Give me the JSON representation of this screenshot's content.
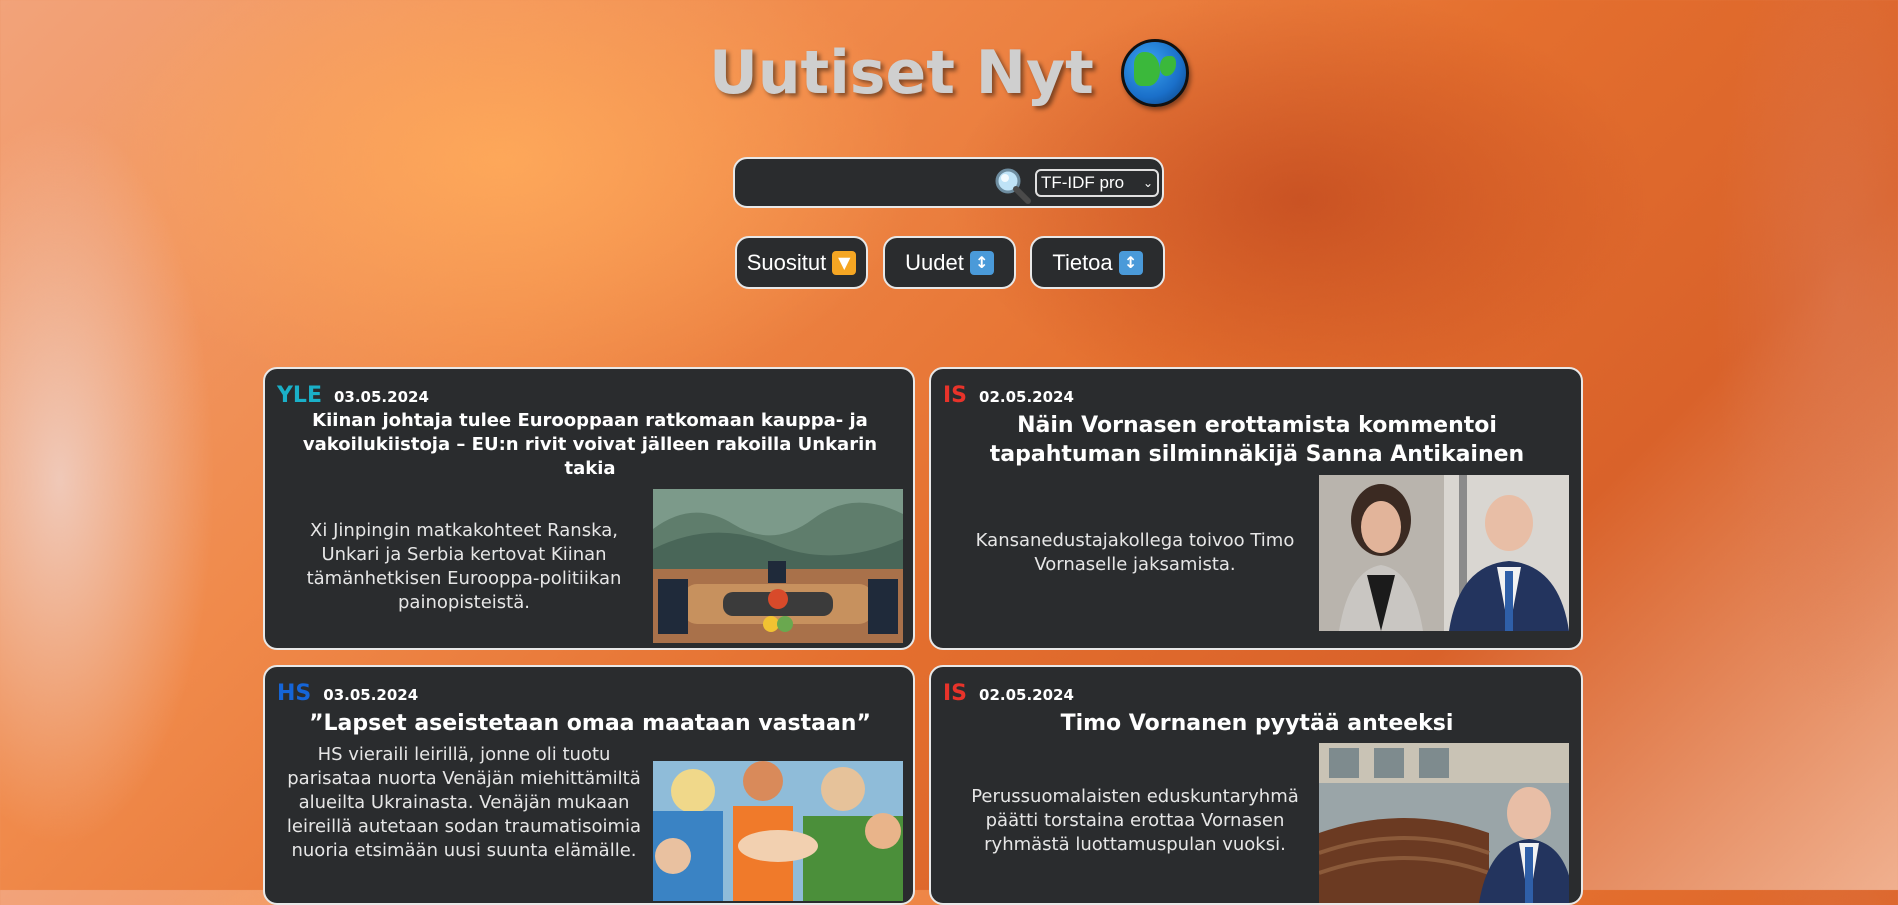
{
  "header": {
    "title": "Uutiset Nyt",
    "logo_icon": "globe-earth-africa-icon"
  },
  "search": {
    "value": "",
    "placeholder": "",
    "algorithm_selected": "TF-IDF pro",
    "icon": "magnifying-glass-icon"
  },
  "nav": {
    "popular_label": "Suositut",
    "popular_icon": "down-arrow-orange-icon",
    "new_label": "Uudet",
    "new_icon": "up-down-arrow-icon",
    "about_label": "Tietoa",
    "about_icon": "up-down-arrow-icon"
  },
  "articles": [
    {
      "source": "YLE",
      "source_color": "#1ab0c8",
      "date": "03.05.2024",
      "headline": "Kiinan johtaja tulee Eurooppaan ratkomaan kauppa- ja vakoilukiistoja – EU:n rivit voivat jälleen rakoilla Unkarin takia",
      "summary": "Xi Jinpingin matkakohteet Ranska, Unkari ja Serbia kertovat Kiinan tämänhetkisen Eurooppa-politiikan painopisteistä.",
      "image": "conference-table-photo"
    },
    {
      "source": "IS",
      "source_color": "#e8332a",
      "date": "02.05.2024",
      "headline": "Näin Vornasen erottamista kommentoi tapahtuman silminnäkijä Sanna Antikainen",
      "summary": "Kansanedustajakollega toivoo Timo Vornaselle jaksamista.",
      "image": "two-portraits-photo"
    },
    {
      "source": "HS",
      "source_color": "#1565d8",
      "date": "03.05.2024",
      "headline": "”Lapset aseistetaan omaa maataan vastaan”",
      "summary": "HS vieraili leirillä, jonne oli tuotu parisataa nuorta Venäjän miehittämiltä alueilta Ukrainasta. Venäjän mukaan leireillä autetaan sodan traumatisoimia nuoria etsimään uusi suunta elämälle.",
      "image": "youth-camp-photo"
    },
    {
      "source": "IS",
      "source_color": "#e8332a",
      "date": "02.05.2024",
      "headline": "Timo Vornanen pyytää anteeksi",
      "summary": "Perussuomalaisten eduskuntaryhmä päätti torstaina erottaa Vornasen ryhmästä luottamuspulan vuoksi.",
      "image": "parliament-and-portrait-photo"
    }
  ]
}
